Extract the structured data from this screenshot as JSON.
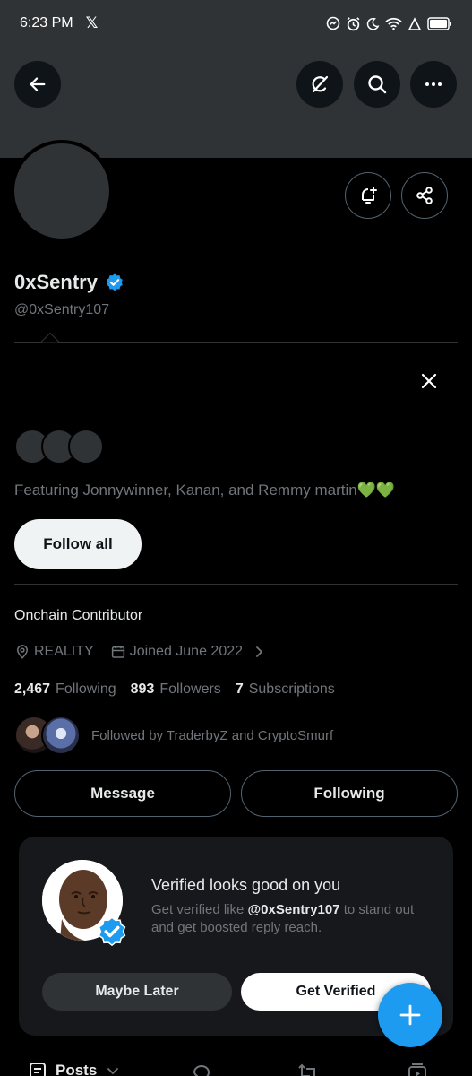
{
  "status_bar": {
    "time": "6:23 PM",
    "app_glyph": "𝕏"
  },
  "profile": {
    "display_name": "0xSentry",
    "handle": "@0xSentry107",
    "bio": "Onchain Contributor",
    "location": "REALITY",
    "joined": "Joined June 2022",
    "following_count": "2,467",
    "following_label": "Following",
    "followers_count": "893",
    "followers_label": "Followers",
    "subscriptions_count": "7",
    "subscriptions_label": "Subscriptions",
    "followed_by": "Followed by TraderbyZ and CryptoSmurf"
  },
  "suggestions": {
    "featuring": "Featuring Jonnywinner, Kanan, and Remmy martin💚💚",
    "follow_all_label": "Follow all"
  },
  "actions": {
    "message_label": "Message",
    "following_label": "Following"
  },
  "verify_card": {
    "title": "Verified looks good on you",
    "desc_prefix": "Get verified like ",
    "desc_handle": "@0xSentry107",
    "desc_suffix": " to stand out and get boosted reply reach.",
    "maybe_later_label": "Maybe Later",
    "get_verified_label": "Get Verified"
  },
  "tabs": {
    "posts_label": "Posts"
  },
  "colors": {
    "accent": "#1d9bf0",
    "background": "#000000",
    "banner": "#2f3336",
    "muted_text": "#71767b"
  },
  "icons": [
    "back-arrow-icon",
    "grok-icon",
    "search-icon",
    "more-icon",
    "notification-add-icon",
    "share-icon",
    "verified-badge-icon",
    "close-icon",
    "location-icon",
    "calendar-icon",
    "chevron-right-icon",
    "plus-icon",
    "posts-icon",
    "chevron-down-icon",
    "reply-icon",
    "repost-icon",
    "media-icon"
  ]
}
